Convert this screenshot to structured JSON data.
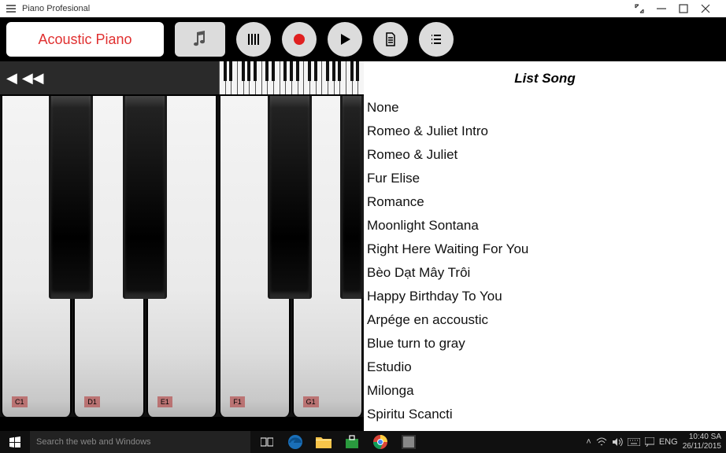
{
  "window": {
    "title": "Piano Profesional"
  },
  "header": {
    "instrument_label": "Acoustic Piano"
  },
  "piano": {
    "white_keys": [
      "C1",
      "D1",
      "E1",
      "F1",
      "G1"
    ]
  },
  "songlist": {
    "heading": "List Song",
    "items": [
      "None",
      "Romeo & Juliet Intro",
      "Romeo & Juliet",
      "Fur Elise",
      "Romance",
      "Moonlight Sontana",
      "Right Here Waiting For You",
      "Bèo Dạt Mây Trôi",
      "Happy Birthday To You",
      "Arpége en accoustic",
      "Blue turn to gray",
      "Estudio",
      "Milonga",
      "Spiritu Scancti"
    ]
  },
  "taskbar": {
    "search_placeholder": "Search the web and Windows",
    "lang": "ENG",
    "time": "10:40 SA",
    "date": "26/11/2015"
  }
}
